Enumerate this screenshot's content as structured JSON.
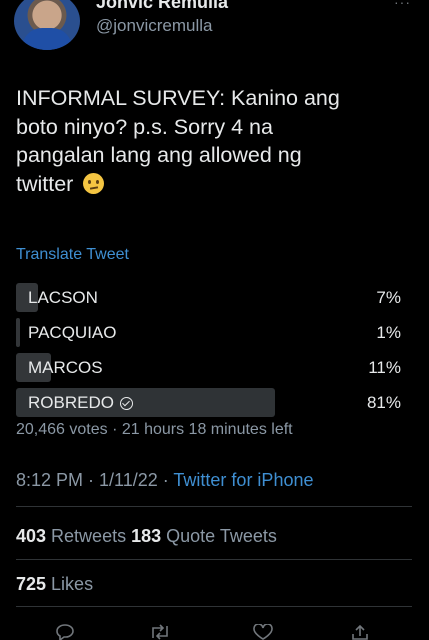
{
  "author": {
    "name": "Jonvic Remulla",
    "handle": "@jonvicremulla",
    "more_label": "···"
  },
  "tweet": {
    "text_line_1": "INFORMAL SURVEY: Kanino ang",
    "text_line_2": "boto ninyo? p.s. Sorry 4 na",
    "text_line_3": "pangalan lang ang allowed ng",
    "text_line_4": "twitter",
    "emoji": "confused-face"
  },
  "translate_label": "Translate Tweet",
  "poll": {
    "options": [
      {
        "label": "LACSON",
        "percent_label": "7%",
        "percent": 7
      },
      {
        "label": "PACQUIAO",
        "percent_label": "1%",
        "percent": 1
      },
      {
        "label": "MARCOS",
        "percent_label": "11%",
        "percent": 11
      },
      {
        "label": "ROBREDO",
        "percent_label": "81%",
        "percent": 81
      }
    ],
    "meta": "20,466 votes · 21 hours 18 minutes left"
  },
  "timestamp": {
    "time": "8:12 PM · 1/11/22 · ",
    "source": "Twitter for iPhone"
  },
  "stats": {
    "retweets_count": "403",
    "retweets_label": " Retweets ",
    "quotes_count": "183",
    "quotes_label": " Quote Tweets",
    "likes_count": "725",
    "likes_label": " Likes"
  },
  "actions": {
    "reply_icon": "reply-icon",
    "retweet_icon": "retweet-icon",
    "like_icon": "heart-icon",
    "share_icon": "share-icon"
  }
}
